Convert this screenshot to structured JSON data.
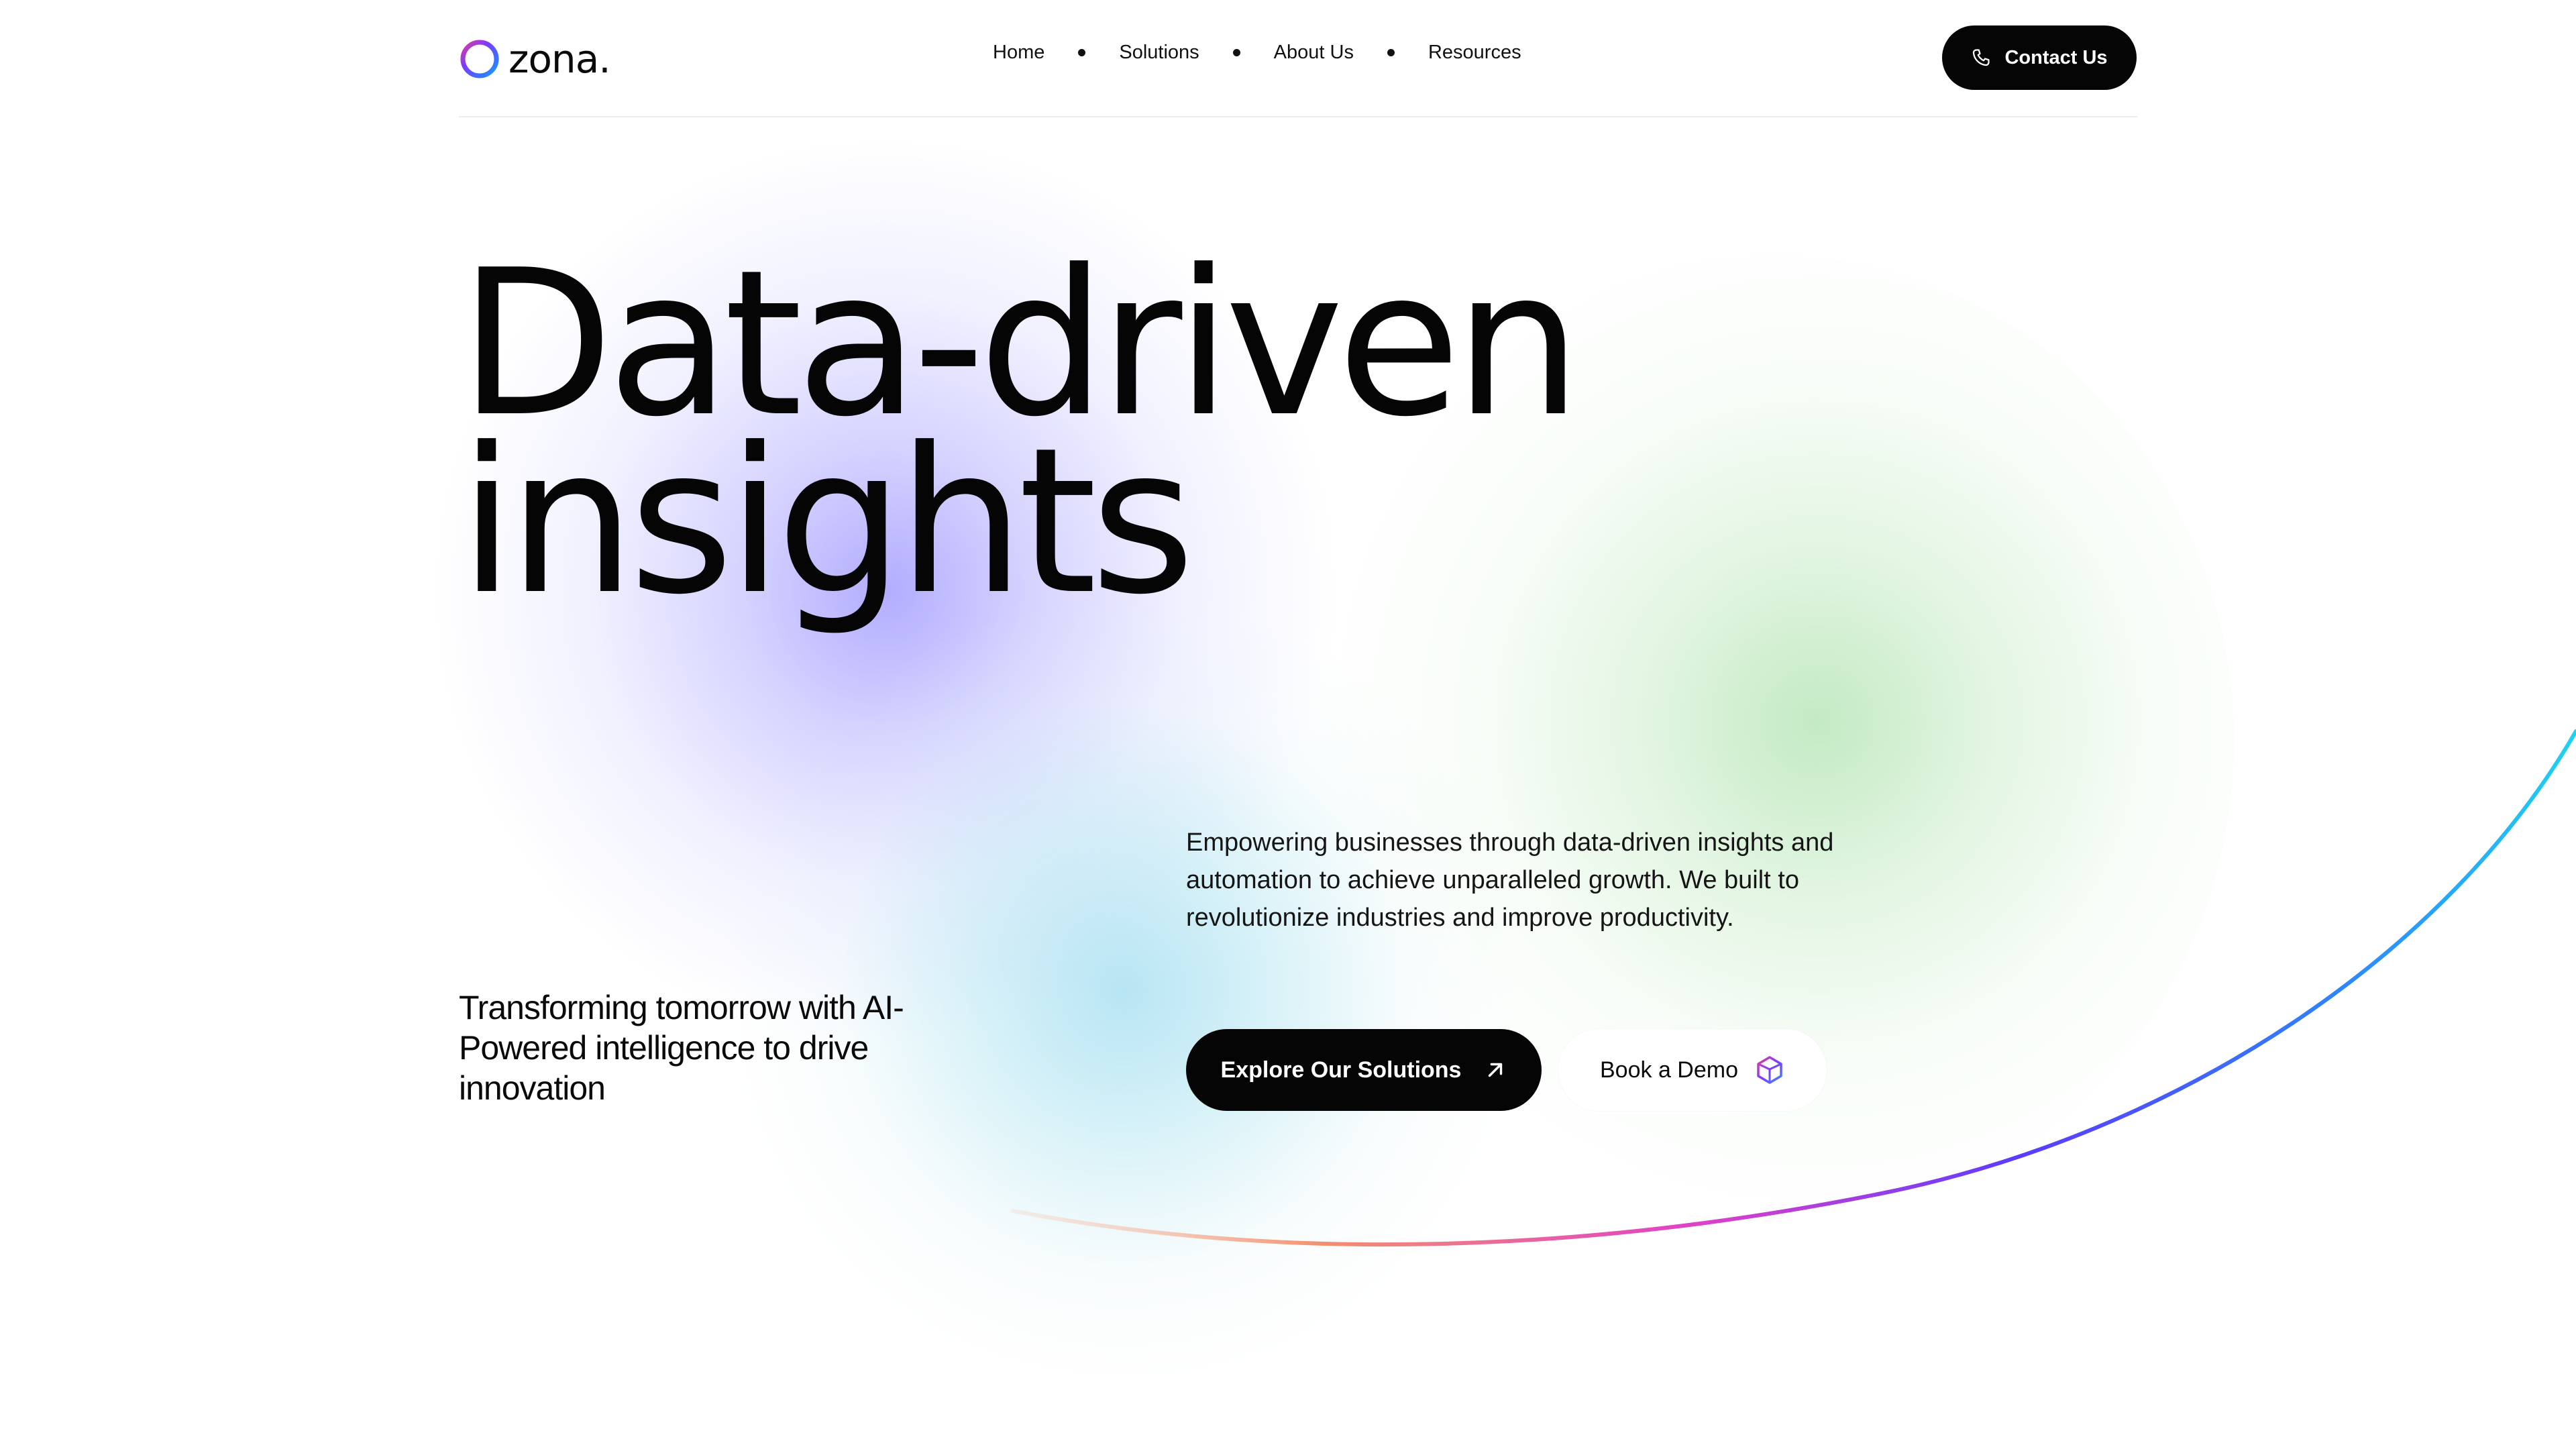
{
  "brand": {
    "name": "zona.",
    "ring_colors": [
      "#ff3d7f",
      "#7b3cff",
      "#2f7bff",
      "#19c6e6"
    ]
  },
  "nav": {
    "items": [
      {
        "label": "Home"
      },
      {
        "label": "Solutions"
      },
      {
        "label": "About Us"
      },
      {
        "label": "Resources"
      }
    ]
  },
  "header": {
    "contact_label": "Contact Us",
    "contact_icon": "phone-icon"
  },
  "hero": {
    "title_line1": "Data-driven",
    "title_line2": "insights",
    "description": "Empowering businesses through data-driven insights and automation to achieve unparalleled growth. We built to revolutionize industries and improve productivity.",
    "tagline": "Transforming tomorrow with AI-Powered intelligence to drive innovation",
    "primary_button": {
      "label": "Explore Our Solutions",
      "icon": "arrow-up-right-icon"
    },
    "secondary_button": {
      "label": "Book a Demo",
      "icon": "cube-logo-icon"
    }
  },
  "colors": {
    "text": "#0a0a0a",
    "button_dark": "#050505",
    "arc_gradient": [
      "#f5a07a",
      "#e040c8",
      "#3a5bff",
      "#1fd4f0"
    ]
  }
}
